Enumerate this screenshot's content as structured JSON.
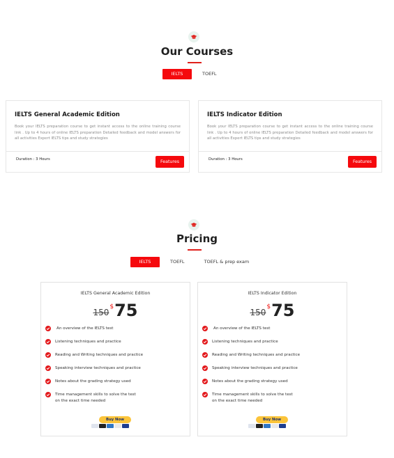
{
  "courses": {
    "title": "Our Courses",
    "tabs": [
      "IELTS",
      "TOEFL"
    ],
    "cards": [
      {
        "title": "IELTS General Academic Edition",
        "description": "Book your IELTS preparation course to get instant access to the online training course link . Up to 4 hours of online IELTS preparation Detailed feedback and model answers for all activities Expert IELTS tips and study strategies",
        "duration": "Duration : 3 Hours",
        "button": "Features"
      },
      {
        "title": "IELTS Indicator Edition",
        "description": "Book your IELTS preparation course to get instant access to the online training course link . Up to 4 hours of online IELTS preparation Detailed feedback and model answers for all activities Expert IELTS tips and study strategies",
        "duration": "Duration : 3 Hours",
        "button": "Features"
      }
    ]
  },
  "pricing": {
    "title": "Pricing",
    "tabs": [
      "IELTS",
      "TOEFL",
      "TOEFL & prep exam"
    ],
    "cards": [
      {
        "title": "IELTS General Academic Edition",
        "old_price": "150",
        "currency": "$",
        "price": "75",
        "features": [
          "An overview of the IELTS test",
          "Listening techniques and practice",
          "Reading and Writing techniques and practice",
          "Speaking interview techniques and practice",
          "Notes about the grading strategy used",
          "Time management skills to solve the test\non the exact time needed"
        ],
        "buy_label": "Buy Now"
      },
      {
        "title": "IELTS Indicator Edition",
        "old_price": "150",
        "currency": "$",
        "price": "75",
        "features": [
          "An overview of the IELTS test",
          "Listening techniques and practice",
          "Reading and Writing techniques and practice",
          "Speaking interview techniques and practice",
          "Notes about the grading strategy used",
          "Time management skills to solve the test\non the exact time needed"
        ],
        "buy_label": "Buy Now"
      }
    ]
  },
  "colors": {
    "accent": "#f5090d",
    "buy_button": "#fbc43a",
    "icon_bg": "#e8f3ee"
  },
  "icons": {
    "section": "graduation-cap-icon",
    "feature": "check-circle-icon",
    "payment": "payment-cards-icon"
  }
}
